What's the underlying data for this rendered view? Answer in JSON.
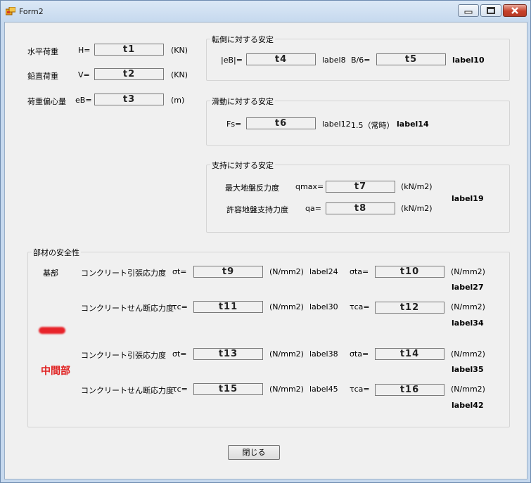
{
  "window": {
    "title": "Form2"
  },
  "colors": {
    "accent_red": "#e02020"
  },
  "load": {
    "h_caption": "水平荷重",
    "h_symbol": "H=",
    "h_value": "t1",
    "h_unit": "(KN)",
    "v_caption": "鉛直荷重",
    "v_symbol": "V=",
    "v_value": "t2",
    "v_unit": "(KN)",
    "e_caption": "荷重偏心量",
    "e_symbol": "eB=",
    "e_value": "t3",
    "e_unit": "(m)"
  },
  "overturn": {
    "title": "転倒に対する安定",
    "eb_symbol": "|eB|=",
    "eb_value": "t4",
    "label8": "label8",
    "b6_symbol": "B/6=",
    "b6_value": "t5",
    "label10": "label10"
  },
  "sliding": {
    "title": "滑動に対する安定",
    "fs_symbol": "Fs=",
    "fs_value": "t6",
    "label12": "label12",
    "normal_text": "1.5（常時）",
    "label14": "label14"
  },
  "bearing": {
    "title": "支持に対する安定",
    "qmax_caption": "最大地盤反力度",
    "qmax_symbol": "qmax=",
    "qmax_value": "t7",
    "qmax_unit": "(kN/m2)",
    "qa_caption": "許容地盤支持力度",
    "qa_symbol": "qa=",
    "qa_value": "t8",
    "qa_unit": "(kN/m2)",
    "label19": "label19"
  },
  "member": {
    "title": "部材の安全性",
    "base_label": "基部",
    "middle_label": "中間部",
    "tension": "コンクリート引張応力度",
    "shear": "コンクリートせん断応力度",
    "sigma_t": "σt=",
    "sigma_ta": "σta=",
    "tau_c": "τc=",
    "tau_ca": "τca=",
    "unit": "(N/mm2)",
    "t9": "t9",
    "t10": "t10",
    "t11": "t11",
    "t12": "t12",
    "t13": "t13",
    "t14": "t14",
    "t15": "t15",
    "t16": "t16",
    "label24": "label24",
    "label27": "label27",
    "label30": "label30",
    "label34": "label34",
    "label38": "label38",
    "label35": "label35",
    "label45": "label45",
    "label42": "label42"
  },
  "close_button": "閉じる"
}
